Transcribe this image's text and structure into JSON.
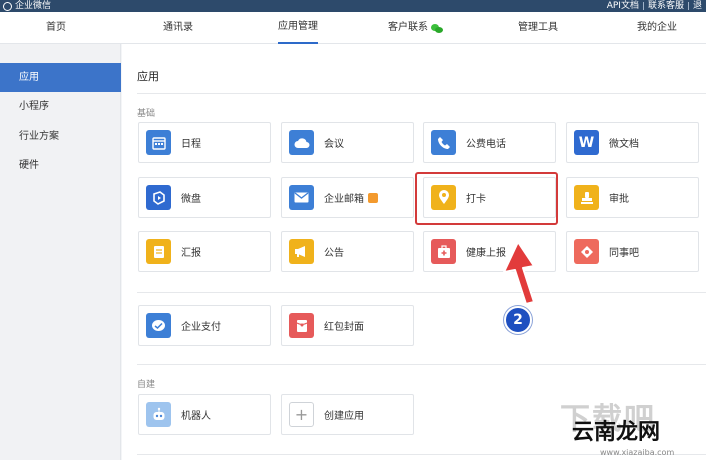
{
  "topbar": {
    "brand": "企业微信",
    "links": [
      "API文档",
      "联系客服",
      "退"
    ]
  },
  "nav": {
    "items": [
      {
        "label": "首页",
        "active": false
      },
      {
        "label": "通讯录",
        "active": false
      },
      {
        "label": "应用管理",
        "active": true
      },
      {
        "label": "客户联系",
        "active": false,
        "icon": "wechat-icon"
      },
      {
        "label": "管理工具",
        "active": false
      },
      {
        "label": "我的企业",
        "active": false
      }
    ]
  },
  "sidebar": {
    "items": [
      {
        "label": "应用",
        "active": true
      },
      {
        "label": "小程序",
        "active": false
      },
      {
        "label": "行业方案",
        "active": false
      },
      {
        "label": "硬件",
        "active": false
      }
    ]
  },
  "main": {
    "title": "应用",
    "sections": {
      "basic": "基础",
      "custom": "自建"
    },
    "apps_basic": [
      {
        "label": "日程",
        "icon": "calendar-icon",
        "color": "#3d7fd6"
      },
      {
        "label": "会议",
        "icon": "cloud-icon",
        "color": "#3d7fd6"
      },
      {
        "label": "公费电话",
        "icon": "phone-icon",
        "color": "#3d7fd6"
      },
      {
        "label": "微文档",
        "icon": "word-icon",
        "color": "#2f6ad0"
      },
      {
        "label": "微盘",
        "icon": "drive-icon",
        "color": "#2f6ad0"
      },
      {
        "label": "企业邮箱",
        "icon": "mail-icon",
        "color": "#3d7fd6"
      },
      {
        "label": "打卡",
        "icon": "location-pin-icon",
        "color": "#f0b21b"
      },
      {
        "label": "审批",
        "icon": "stamp-icon",
        "color": "#f0b21b"
      },
      {
        "label": "汇报",
        "icon": "report-icon",
        "color": "#f0b21b"
      },
      {
        "label": "公告",
        "icon": "megaphone-icon",
        "color": "#f0b21b"
      },
      {
        "label": "健康上报",
        "icon": "health-kit-icon",
        "color": "#e65a5a"
      },
      {
        "label": "同事吧",
        "icon": "colleague-icon",
        "color": "#ee6a5d"
      }
    ],
    "apps_pay": [
      {
        "label": "企业支付",
        "icon": "payment-icon",
        "color": "#3d7fd6"
      },
      {
        "label": "红包封面",
        "icon": "red-packet-icon",
        "color": "#e65a5a"
      }
    ],
    "apps_custom": [
      {
        "label": "机器人",
        "icon": "robot-icon",
        "color": "#9ec4ee"
      },
      {
        "label": "创建应用",
        "icon": "plus-icon",
        "color": "#ffffff"
      }
    ]
  },
  "annotation": {
    "step": "2",
    "highlight_color": "#d33a3a",
    "badge_color": "#1e4fc0"
  },
  "watermark": {
    "big": "下载吧",
    "mid": "云南龙网",
    "small": "www.xiazaiba.com"
  },
  "colors": {
    "topbar": "#2d4a6b",
    "accent": "#3c74c9"
  }
}
